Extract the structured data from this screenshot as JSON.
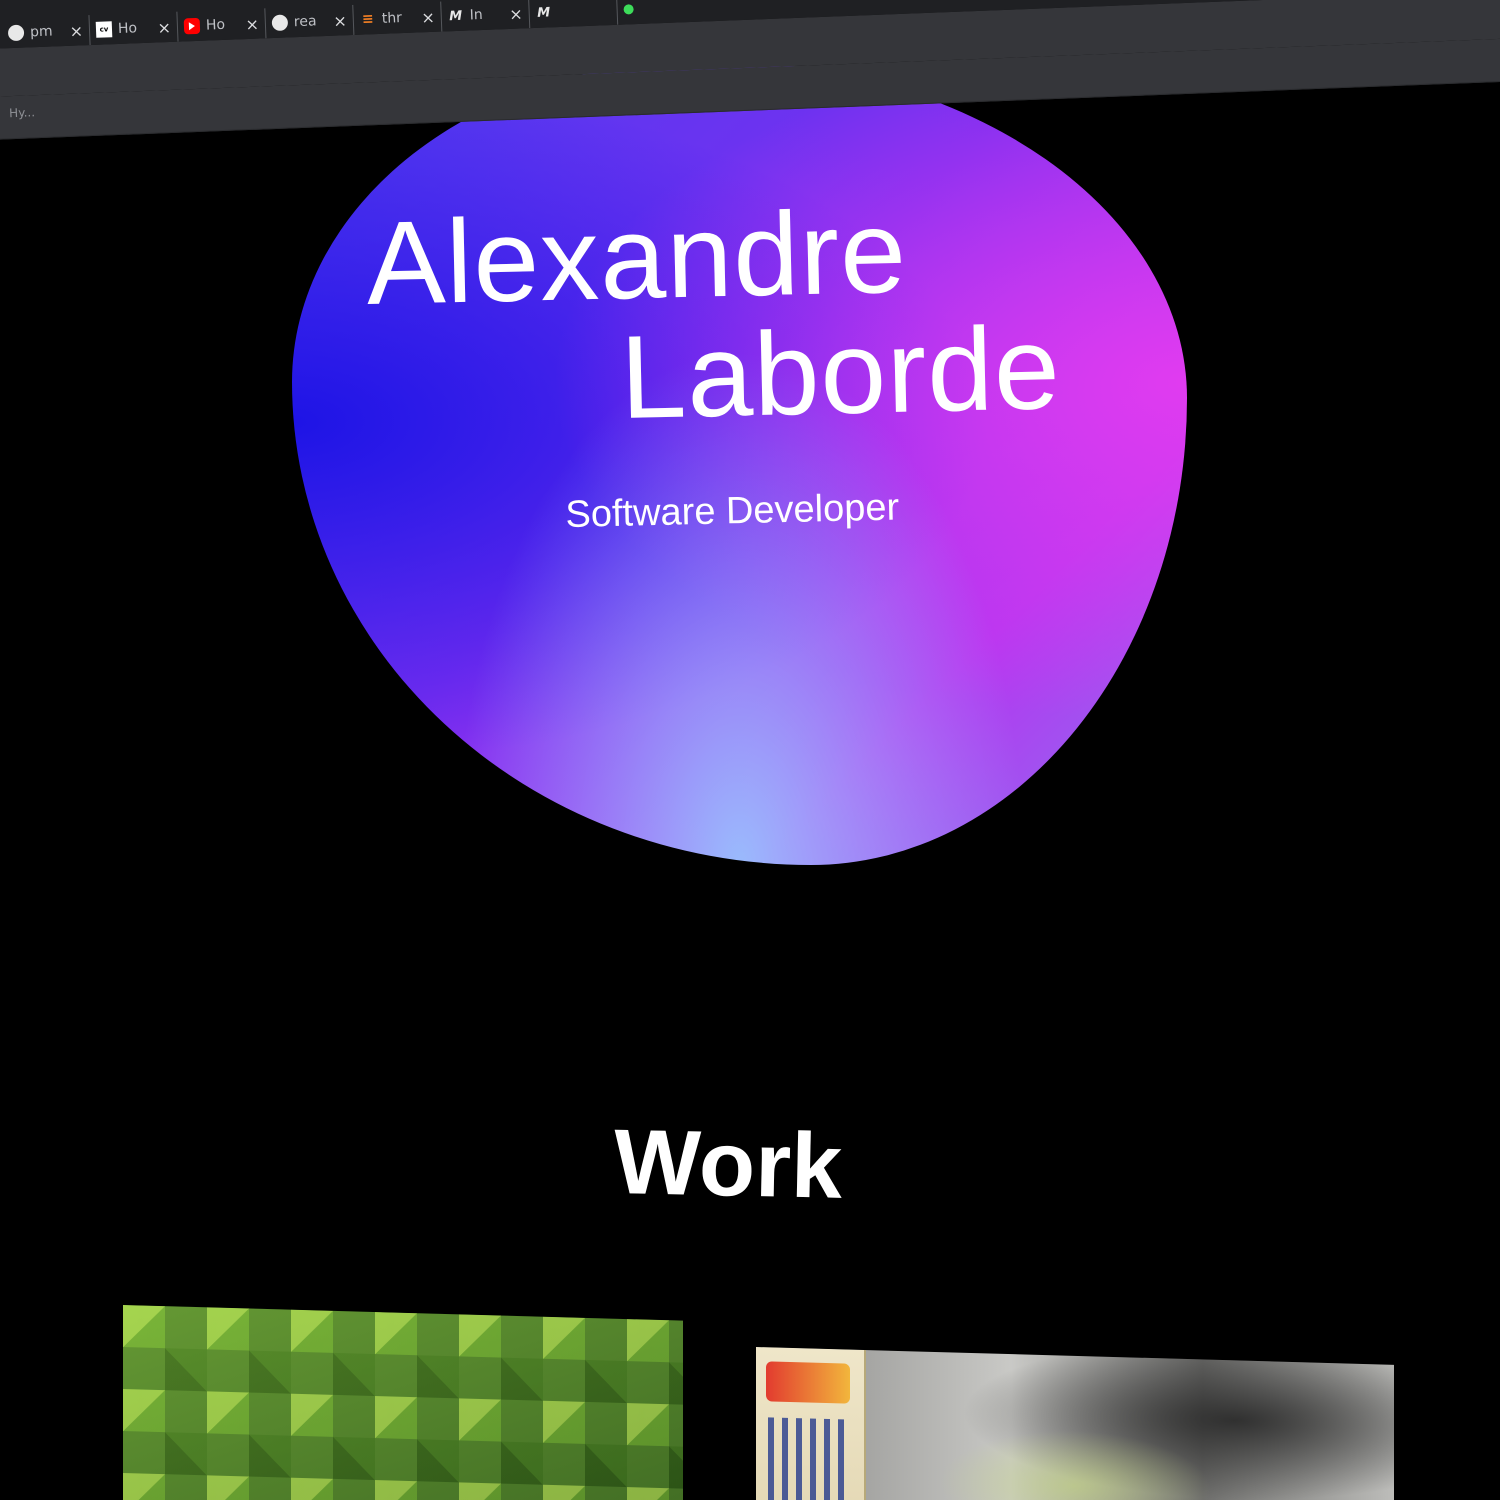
{
  "browser": {
    "tabs": [
      {
        "favicon": "github-icon",
        "title": "pm",
        "close": "×"
      },
      {
        "favicon": "cv-icon",
        "title": "Ho",
        "close": "×"
      },
      {
        "favicon": "youtube-icon",
        "title": "Ho",
        "close": "×"
      },
      {
        "favicon": "github-icon",
        "title": "rea",
        "close": "×"
      },
      {
        "favicon": "stackoverflow-icon",
        "title": "thr",
        "close": "×"
      },
      {
        "favicon": "medium-icon",
        "title": "In",
        "close": "×"
      }
    ],
    "bookmark_label": "Hy..."
  },
  "hero": {
    "first_name": "Alexandre",
    "last_name": "Laborde",
    "subtitle": "Software Developer",
    "colors": {
      "blob_blue": "#1f1ae6",
      "blob_purple": "#8a2ff0",
      "blob_magenta": "#d23cf0",
      "blob_light_blue": "#7fc8ff"
    }
  },
  "work": {
    "title": "Work",
    "items": [
      {
        "image": "green-cubes-thumbnail"
      },
      {
        "image": "japanese-poster-thumbnail"
      }
    ]
  }
}
